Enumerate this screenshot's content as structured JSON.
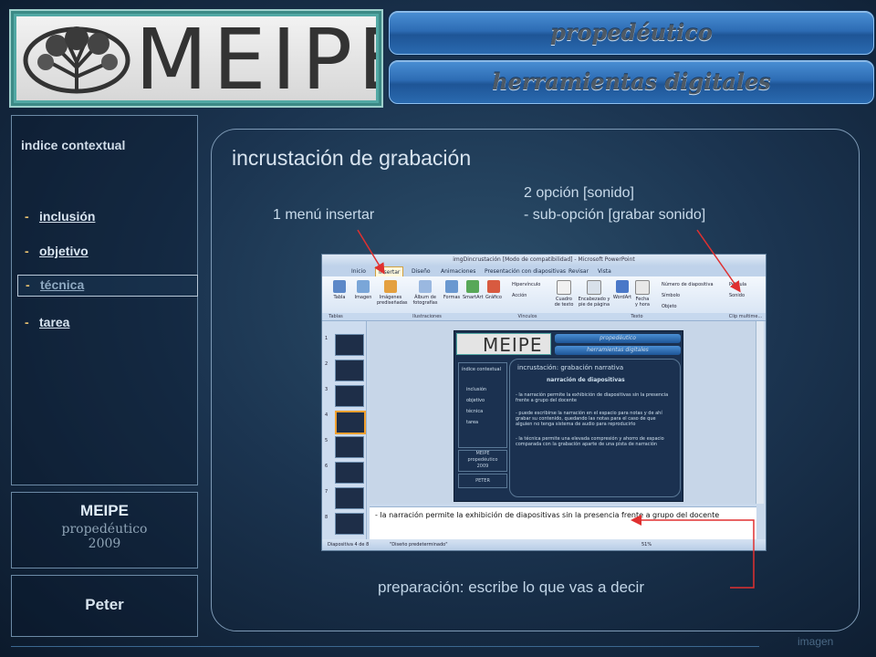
{
  "header": {
    "logo_text": "MEIPE",
    "pill_top": "propedéutico",
    "pill_bottom": "herramientas digitales"
  },
  "sidebar": {
    "title": "indice contextual",
    "items": [
      {
        "dash": "-",
        "label": "inclusión"
      },
      {
        "dash": "-",
        "label": "objetivo"
      },
      {
        "dash": "-",
        "label": "técnica"
      },
      {
        "dash": "-",
        "label": "tarea"
      }
    ],
    "meipe_box": {
      "title": "MEIPE",
      "subtitle": "propedéutico",
      "year": "2009"
    },
    "author_box": {
      "name": "Peter"
    }
  },
  "slide": {
    "title": "incrustación de grabación",
    "annotation_1": "1 menú insertar",
    "annotation_2a": "2 opción [sonido]",
    "annotation_2b": "- sub-opción [grabar sonido]",
    "annotation_prep": "preparación: escribe lo que vas a decir",
    "footer_label": "imagen"
  },
  "ppt": {
    "window_title": "imgDincrustación [Modo de compatibilidad] - Microsoft PowerPoint",
    "tabs": [
      "Inicio",
      "Insertar",
      "Diseño",
      "Animaciones",
      "Presentación con diapositivas",
      "Revisar",
      "Vista"
    ],
    "ribbon": {
      "tabla": "Tabla",
      "imagen": "Imagen",
      "imagenes_prediseñadas": "Imágenes prediseñadas",
      "album": "Álbum de fotografías",
      "formas": "Formas",
      "smartart": "SmartArt",
      "grafico": "Gráfico",
      "hipervinculo": "Hipervínculo",
      "accion": "Acción",
      "cuadro_texto": "Cuadro de texto",
      "encabezado": "Encabezado y pie de página",
      "wordart": "WordArt",
      "fecha": "Fecha y hora",
      "numero_diapositiva": "Número de diapositiva",
      "simbolo": "Símbolo",
      "objeto": "Objeto",
      "pelicula": "Película",
      "sonido": "Sonido",
      "grp_tablas": "Tablas",
      "grp_ilustraciones": "Ilustraciones",
      "grp_vinculos": "Vínculos",
      "grp_texto": "Texto",
      "grp_clip": "Clip multime..."
    },
    "thumb_numbers": [
      "1",
      "2",
      "3",
      "4",
      "5",
      "6",
      "7",
      "8"
    ],
    "mini_slide": {
      "logo": "MEIPE",
      "pill_top": "propedéutico",
      "pill_bottom": "herramientas digitales",
      "side_title": "índice contextual",
      "side_items": [
        "inclusión",
        "objetivo",
        "técnica",
        "tarea"
      ],
      "meipe": "MEIPE",
      "meipe_sub": "propedéutico",
      "meipe_year": "2009",
      "peter": "PETER",
      "title": "incrustación: grabación narrativa",
      "subtitle": "narración de diapositivas",
      "bullet_1": "- la narración permite la exhibición de diapositivas sin la presencia frente a grupo del docente",
      "bullet_2": "- puede escribirse la narración en el espacio para notas y de ahí grabar su contenido, quedando las notas para el caso de que alguien no tenga sistema de audio para reproducirlo",
      "bullet_3": "- la técnica permite una elevada compresión y ahorro de espacio comparada con la grabación aparte de una pista de narración"
    },
    "notes_text": "- la narración permite la exhibición de diapositivas sin la presencia frente a grupo del docente",
    "status_slide": "Diapositiva 4 de 8",
    "status_theme": "\"Diseño predeterminado\"",
    "status_zoom": "51%"
  },
  "colors": {
    "accent": "#2d6cb4",
    "annotation_arrow": "#e03030",
    "background": "#1b3450"
  }
}
